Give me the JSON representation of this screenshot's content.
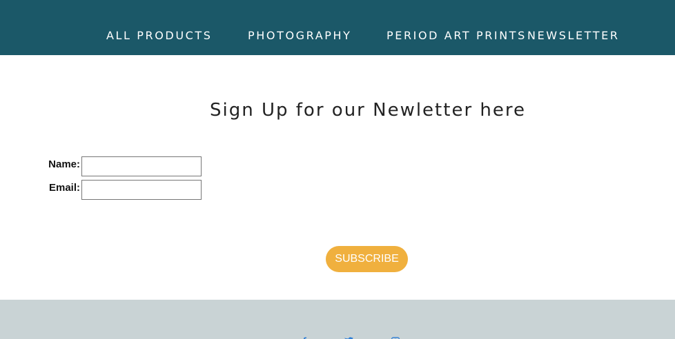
{
  "nav": {
    "items": [
      {
        "label": "ALL PRODUCTS"
      },
      {
        "label": "PHOTOGRAPHY"
      },
      {
        "label": "PERIOD ART PRINTS"
      },
      {
        "label": "NEWSLETTER"
      }
    ],
    "background": "#1b5868"
  },
  "main": {
    "title": "Sign Up for our Newletter here",
    "form": {
      "name_label": "Name:",
      "name_value": "",
      "email_label": "Email:",
      "email_value": "",
      "subscribe_label": "SUBSCRIBE"
    },
    "accent": "#f0b03e"
  },
  "footer": {
    "background": "#c9d3d5",
    "icons": [
      "facebook-icon",
      "twitter-icon",
      "instagram-icon"
    ],
    "icon_color": "#2f7fd6"
  }
}
